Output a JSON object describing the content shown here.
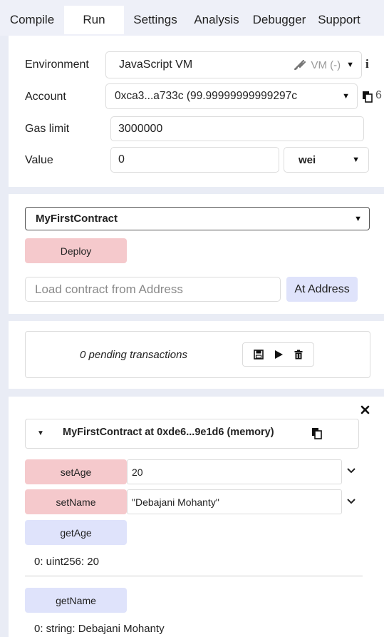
{
  "tabs": [
    "Compile",
    "Run",
    "Settings",
    "Analysis",
    "Debugger",
    "Support"
  ],
  "active_tab": "Run",
  "environment": {
    "label": "Environment",
    "value": "JavaScript VM",
    "vm_badge": "VM (-)",
    "info_icon": "i"
  },
  "account": {
    "label": "Account",
    "value": "0xca3...a733c (99.99999999999297с"
  },
  "gas_limit": {
    "label": "Gas limit",
    "value": "3000000"
  },
  "value": {
    "label": "Value",
    "amount": "0",
    "unit": "wei"
  },
  "contract_select": {
    "value": "MyFirstContract"
  },
  "deploy_label": "Deploy",
  "load_address": {
    "placeholder": "Load contract from Address",
    "button": "At Address"
  },
  "pending": {
    "text": "0 pending transactions"
  },
  "instance": {
    "title": "MyFirstContract at 0xde6...9e1d6 (memory)",
    "functions": [
      {
        "name": "setAge",
        "input": "20",
        "kind": "transact"
      },
      {
        "name": "setName",
        "input": "\"Debajani Mohanty\"",
        "kind": "transact"
      },
      {
        "name": "getAge",
        "kind": "call",
        "output": "0: uint256: 20"
      },
      {
        "name": "getName",
        "kind": "call",
        "output": "0: string: Debajani Mohanty"
      }
    ]
  },
  "colors": {
    "transact": "#f5c9cc",
    "call": "#dfe3fb",
    "active_tab_bg": "#ffffff",
    "page_bg": "#e9ecf5"
  },
  "icons": {
    "vm_plug": "plug-icon",
    "account_copy": "copy-icon",
    "save": "save-icon",
    "play": "play-icon",
    "trash": "trash-icon",
    "close": "close-icon",
    "collapse": "caret-down-icon",
    "instance_copy": "copy-icon",
    "expand": "chevron-down-icon"
  }
}
